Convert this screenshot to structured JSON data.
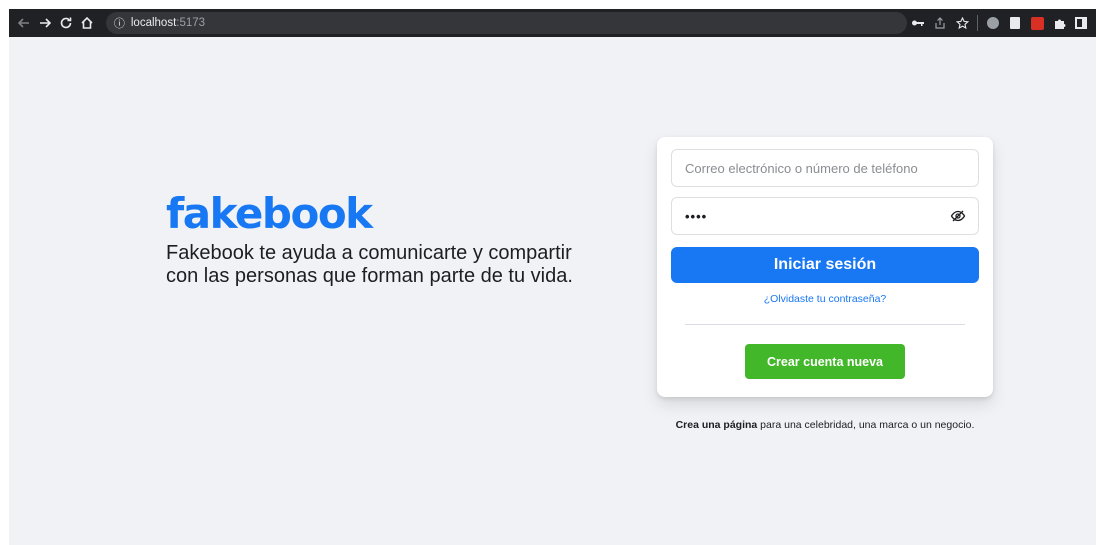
{
  "browser": {
    "url_host": "localhost",
    "url_port": ":5173",
    "back_icon": "arrow-left",
    "forward_icon": "arrow-right",
    "reload_icon": "reload",
    "home_icon": "home",
    "info_icon": "ⓘ"
  },
  "brand": {
    "logo_text": "fakebook",
    "tagline": "Fakebook te ayuda a comunicarte y compartir con las personas que forman parte de tu vida.",
    "color": "#1877f2"
  },
  "login": {
    "email_placeholder": "Correo electrónico o número de teléfono",
    "email_value": "",
    "password_value": "••••",
    "login_label": "Iniciar sesión",
    "forgot_label": "¿Olvidaste tu contraseña?",
    "create_label": "Crear cuenta nueva",
    "create_color": "#42b72a"
  },
  "footer": {
    "strong": "Crea una página",
    "rest": " para una celebridad, una marca o un negocio."
  }
}
